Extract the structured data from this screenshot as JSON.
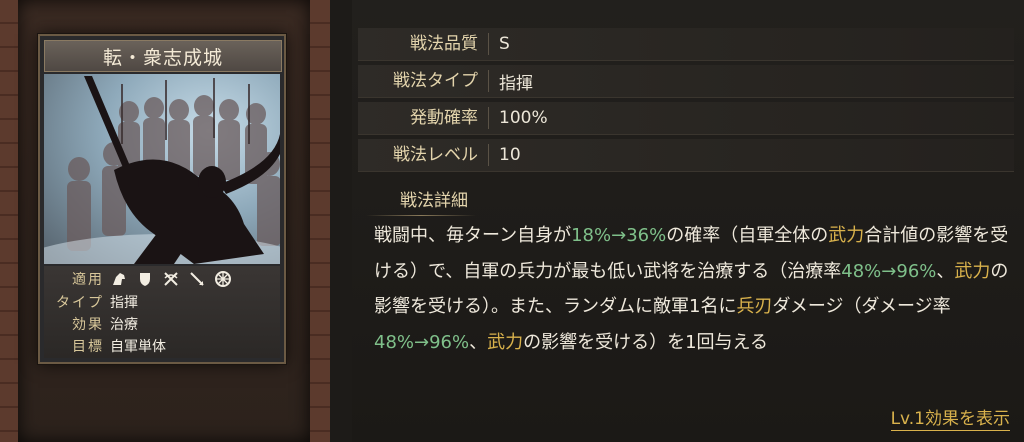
{
  "skill_card": {
    "name": "転・衆志成城",
    "stats": {
      "apply_label": "適用",
      "apply_icons": [
        "cavalry-icon",
        "shield-icon",
        "bow-icon",
        "spear-icon",
        "wheel-icon"
      ],
      "type_label": "タイプ",
      "type_value": "指揮",
      "effect_label": "効果",
      "effect_value": "治療",
      "target_label": "目標",
      "target_value": "自軍単体"
    }
  },
  "info": {
    "quality_label": "戦法品質",
    "quality_value": "S",
    "type_label": "戦法タイプ",
    "type_value": "指揮",
    "rate_label": "発動確率",
    "rate_value": "100%",
    "level_label": "戦法レベル",
    "level_value": "10"
  },
  "detail": {
    "heading": "戦法詳細",
    "segments": [
      {
        "text": "戦闘中、毎ターン自身が",
        "style": "normal"
      },
      {
        "text": "18%→36%",
        "style": "green"
      },
      {
        "text": "の確率（自軍全体の",
        "style": "normal"
      },
      {
        "text": "武力",
        "style": "gold"
      },
      {
        "text": "合計値の影響を受ける）で、自軍の兵力が最も低い武将を治療する（治療率",
        "style": "normal"
      },
      {
        "text": "48%→96%",
        "style": "green"
      },
      {
        "text": "、",
        "style": "normal"
      },
      {
        "text": "武力",
        "style": "gold"
      },
      {
        "text": "の影響を受ける）。また、ランダムに敵軍1名に",
        "style": "normal"
      },
      {
        "text": "兵刃",
        "style": "gold"
      },
      {
        "text": "ダメージ（ダメージ率",
        "style": "normal"
      },
      {
        "text": "48%→96%",
        "style": "green"
      },
      {
        "text": "、",
        "style": "normal"
      },
      {
        "text": "武力",
        "style": "gold"
      },
      {
        "text": "の影響を受ける）を1回与える",
        "style": "normal"
      }
    ],
    "colors": {
      "green": "#7fc08a",
      "gold": "#d9b24c"
    }
  },
  "footer": {
    "lv1_link": "Lv.1効果を表示"
  }
}
